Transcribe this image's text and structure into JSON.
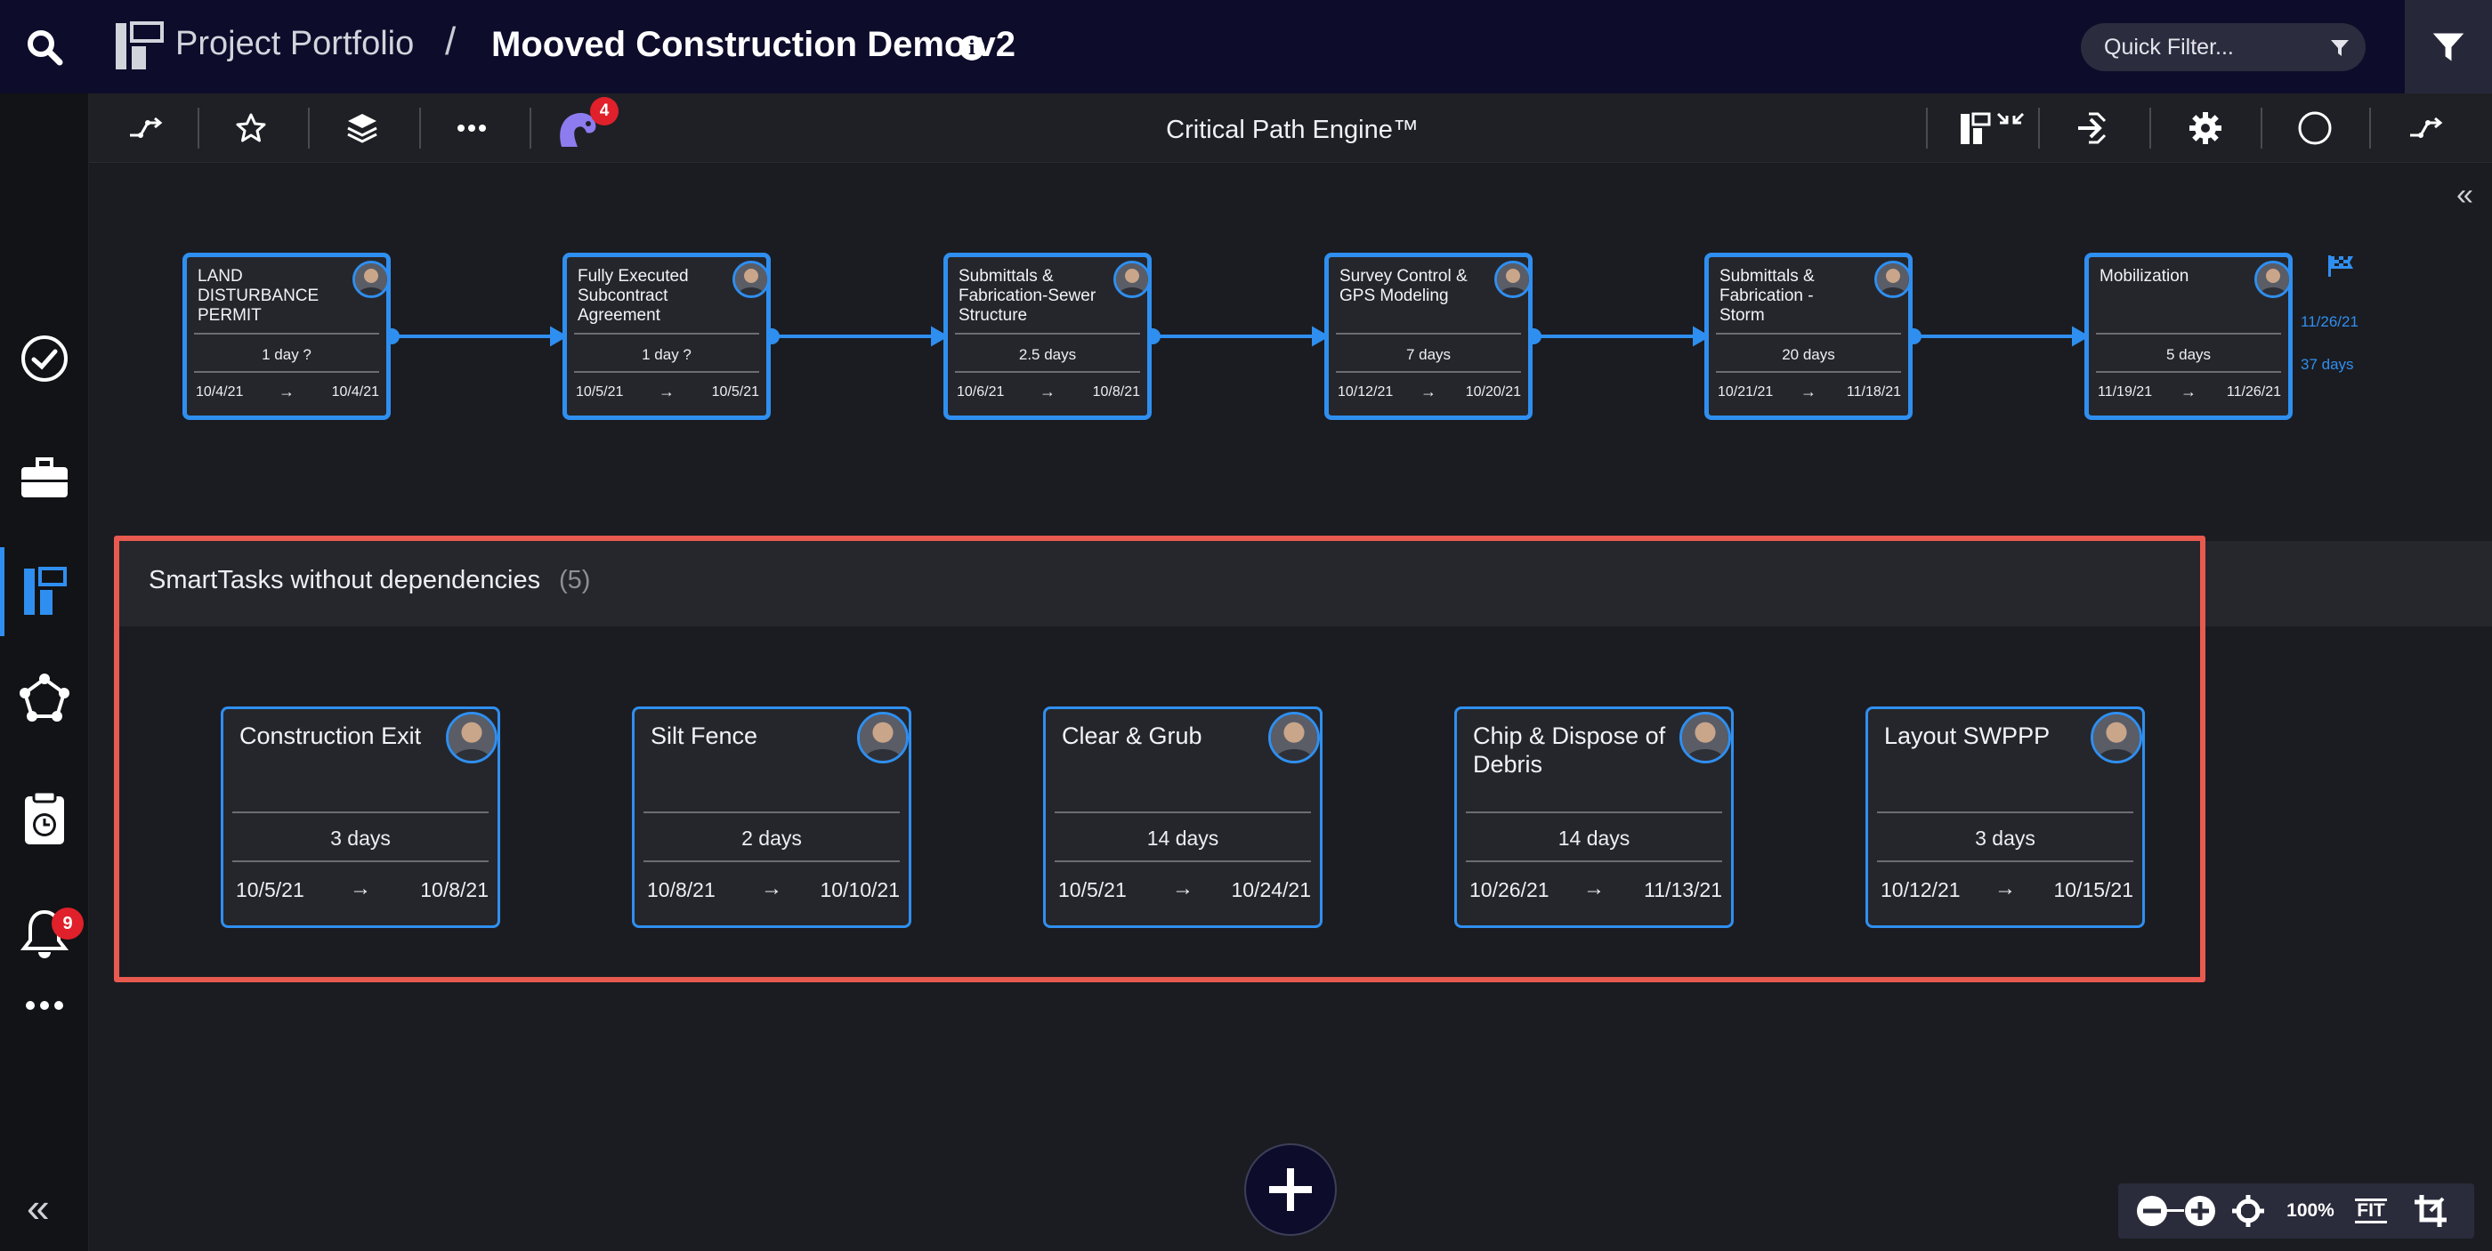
{
  "header": {
    "portfolio": "Project Portfolio",
    "separator": "/",
    "project": "Mooved Construction Demo v2",
    "info": "i",
    "quick_filter_placeholder": "Quick Filter..."
  },
  "sidebar": {
    "notifications_badge": "9",
    "collapse": "«"
  },
  "toolbar": {
    "engine_title": "Critical Path Engine™",
    "assist_badge": "4"
  },
  "critical_path": {
    "tasks": [
      {
        "name": "LAND DISTURBANCE PERMIT",
        "duration": "1 day ?",
        "start": "10/4/21",
        "end": "10/4/21"
      },
      {
        "name": "Fully Executed Subcontract Agreement",
        "duration": "1 day ?",
        "start": "10/5/21",
        "end": "10/5/21"
      },
      {
        "name": "Submittals & Fabrication-Sewer Structure",
        "duration": "2.5 days",
        "start": "10/6/21",
        "end": "10/8/21"
      },
      {
        "name": "Survey Control & GPS Modeling",
        "duration": "7 days",
        "start": "10/12/21",
        "end": "10/20/21"
      },
      {
        "name": "Submittals & Fabrication - Storm",
        "duration": "20 days",
        "start": "10/21/21",
        "end": "11/18/21"
      },
      {
        "name": "Mobilization",
        "duration": "5 days",
        "start": "11/19/21",
        "end": "11/26/21"
      }
    ],
    "arrow": "→",
    "end_date": "11/26/21",
    "total_duration": "37 days",
    "collapse": "«"
  },
  "smart_tasks": {
    "title": "SmartTasks without dependencies",
    "count": "(5)",
    "tasks": [
      {
        "name": "Construction Exit",
        "duration": "3 days",
        "start": "10/5/21",
        "end": "10/8/21"
      },
      {
        "name": "Silt Fence",
        "duration": "2 days",
        "start": "10/8/21",
        "end": "10/10/21"
      },
      {
        "name": "Clear & Grub",
        "duration": "14 days",
        "start": "10/5/21",
        "end": "10/24/21"
      },
      {
        "name": "Chip & Dispose of Debris",
        "duration": "14 days",
        "start": "10/26/21",
        "end": "11/13/21"
      },
      {
        "name": "Layout SWPPP",
        "duration": "3 days",
        "start": "10/12/21",
        "end": "10/15/21"
      }
    ]
  },
  "zoom": {
    "level": "100%",
    "fit": "FIT"
  },
  "colors": {
    "accent": "#2f8ff0",
    "header_bg": "#0d0c2b",
    "canvas_bg": "#1b1c21",
    "highlight": "#e85a4f",
    "badge": "#e0202a"
  }
}
